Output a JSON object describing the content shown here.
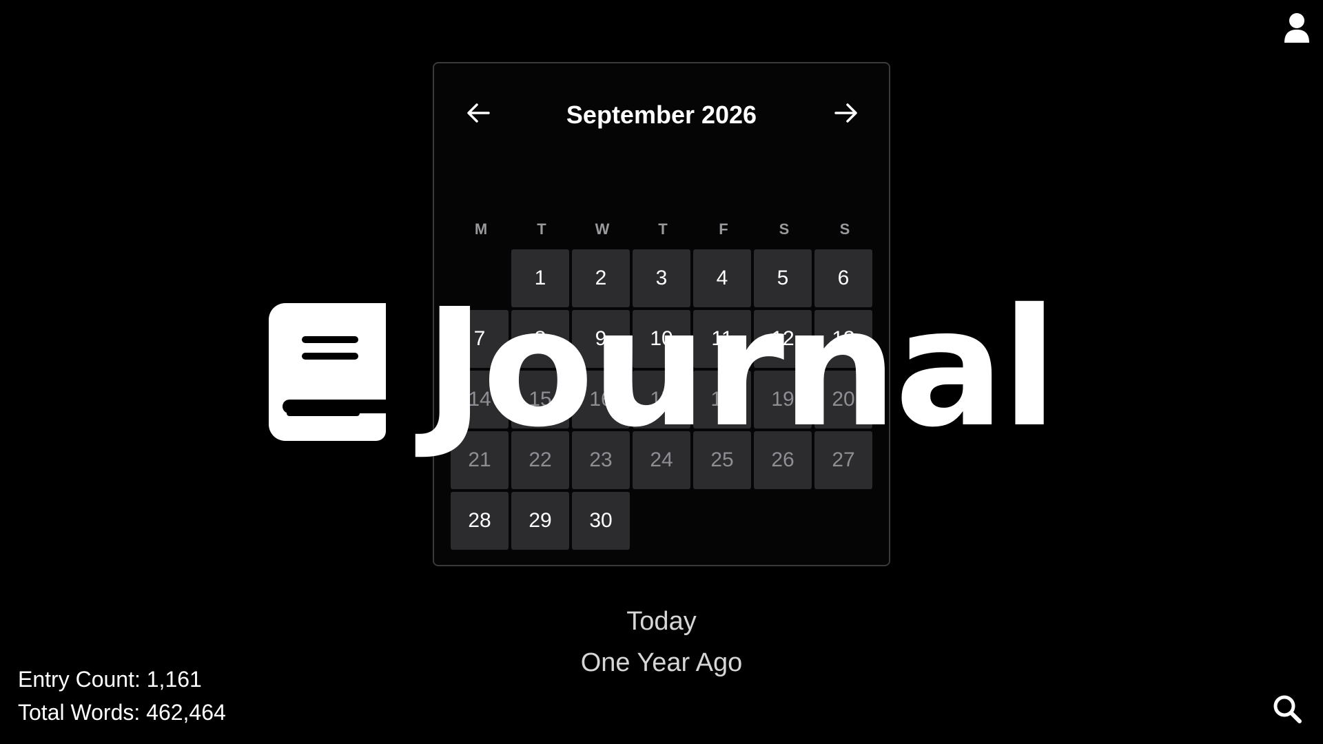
{
  "calendar": {
    "title": "September 2026",
    "weekdays": [
      "M",
      "T",
      "W",
      "T",
      "F",
      "S",
      "S"
    ],
    "days": [
      "1",
      "2",
      "3",
      "4",
      "5",
      "6",
      "7",
      "8",
      "9",
      "10",
      "11",
      "12",
      "13",
      "14",
      "15",
      "16",
      "17",
      "18",
      "19",
      "20",
      "21",
      "22",
      "23",
      "24",
      "25",
      "26",
      "27",
      "28",
      "29",
      "30"
    ]
  },
  "splash": {
    "title": "Journal"
  },
  "links": {
    "today": "Today",
    "one_year_ago": "One Year Ago"
  },
  "stats": {
    "entry_count": "Entry Count: 1,161",
    "total_words": "Total Words: 462,464"
  },
  "icons": {
    "user": "user-icon",
    "search": "search-icon",
    "prev": "arrow-left-icon",
    "next": "arrow-right-icon",
    "book": "book-icon"
  },
  "colors": {
    "background": "#000000",
    "day_cell": "#2c2c2e",
    "border": "#3a3a3c",
    "text": "#ffffff",
    "muted": "#9a9a9e"
  }
}
